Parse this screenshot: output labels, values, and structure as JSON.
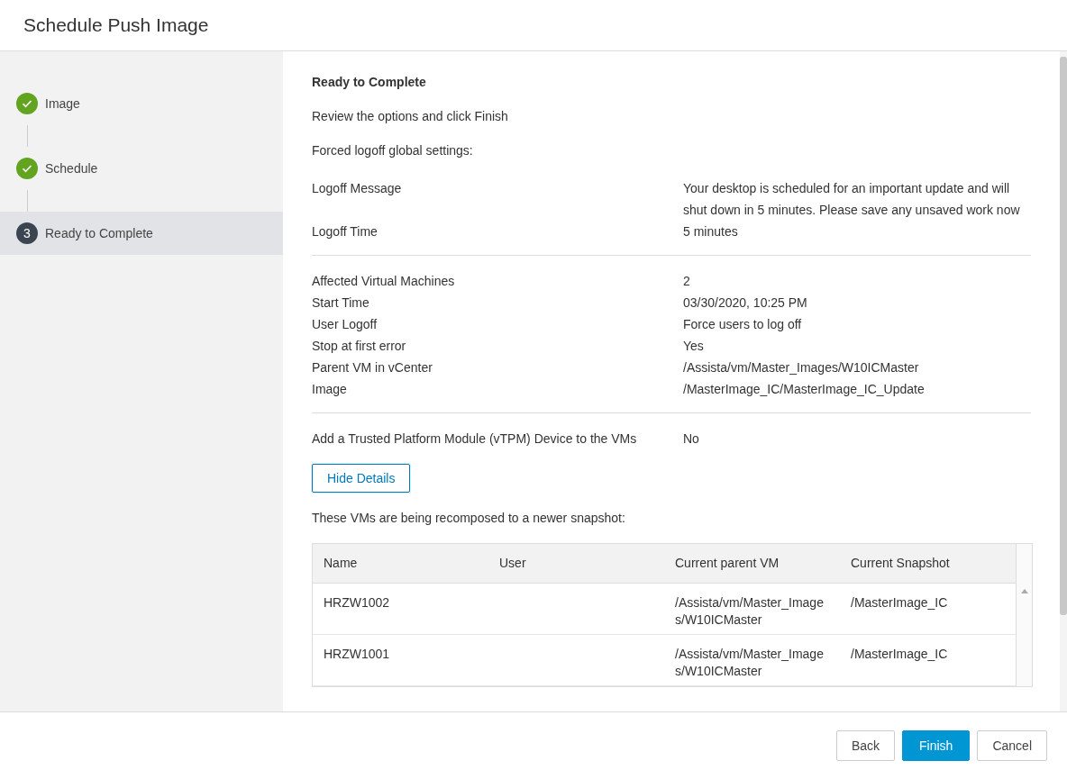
{
  "dialog": {
    "title": "Schedule Push Image"
  },
  "steps": [
    {
      "label": "Image",
      "completed": true,
      "selected": false
    },
    {
      "label": "Schedule",
      "completed": true,
      "selected": false
    },
    {
      "label": "Ready to Complete",
      "completed": false,
      "number": "3",
      "selected": true
    }
  ],
  "content": {
    "heading": "Ready to Complete",
    "intro": "Review the options and click Finish",
    "settings_label": "Forced logoff global settings:",
    "groups": [
      [
        {
          "label": "Logoff Message",
          "value": "Your desktop is scheduled for an important update and will shut down in 5 minutes. Please save any unsaved work now"
        },
        {
          "label": "Logoff Time",
          "value": "5 minutes"
        }
      ],
      [
        {
          "label": "Affected Virtual Machines",
          "value": "2"
        },
        {
          "label": "Start Time",
          "value": "03/30/2020, 10:25 PM"
        },
        {
          "label": "User Logoff",
          "value": "Force users to log off"
        },
        {
          "label": "Stop at first error",
          "value": "Yes"
        },
        {
          "label": "Parent VM in vCenter",
          "value": "/Assista/vm/Master_Images/W10ICMaster"
        },
        {
          "label": "Image",
          "value": "/MasterImage_IC/MasterImage_IC_Update"
        }
      ],
      [
        {
          "label": "Add a Trusted Platform Module (vTPM) Device to the VMs",
          "value": "No"
        }
      ]
    ],
    "details_button": "Hide Details",
    "table_caption": "These VMs are being recomposed to a newer snapshot:"
  },
  "table": {
    "columns": [
      "Name",
      "User",
      "Current parent VM",
      "Current Snapshot"
    ],
    "rows": [
      [
        "HRZW1002",
        "",
        "/Assista/vm/Master_Images/W10ICMaster",
        "/MasterImage_IC"
      ],
      [
        "HRZW1001",
        "",
        "/Assista/vm/Master_Images/W10ICMaster",
        "/MasterImage_IC"
      ]
    ]
  },
  "buttons": [
    {
      "label": "Back",
      "kind": "secondary"
    },
    {
      "label": "Finish",
      "kind": "primary"
    },
    {
      "label": "Cancel",
      "kind": "secondary"
    }
  ]
}
